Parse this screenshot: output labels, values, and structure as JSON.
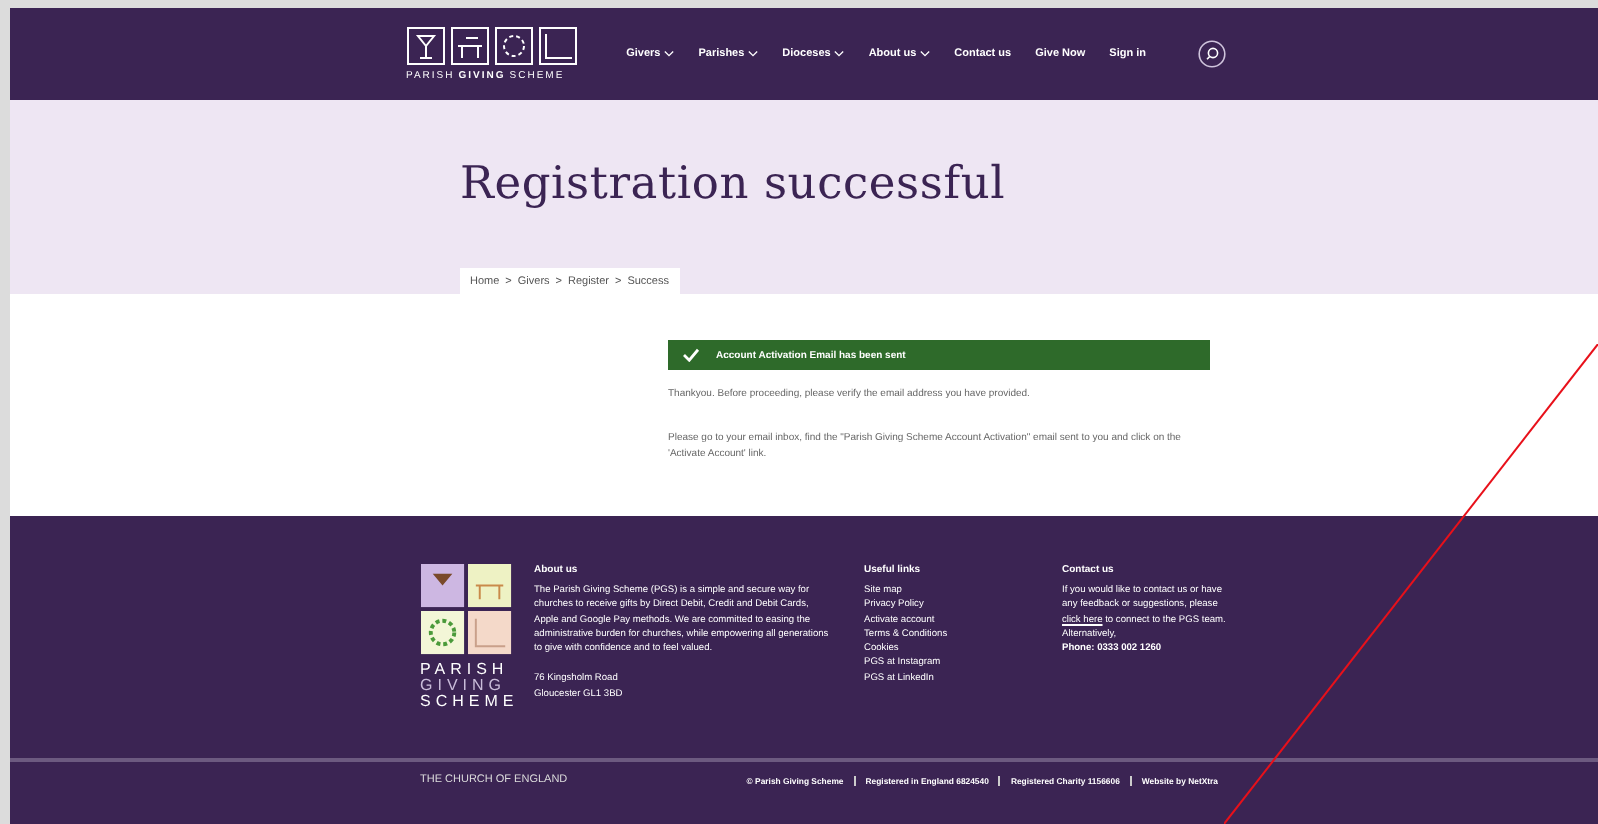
{
  "header": {
    "logo_text": [
      "PARISH",
      "GIVING",
      "SCHEME"
    ],
    "nav": [
      {
        "label": "Givers",
        "dropdown": true
      },
      {
        "label": "Parishes",
        "dropdown": true
      },
      {
        "label": "Dioceses",
        "dropdown": true
      },
      {
        "label": "About us",
        "dropdown": true
      },
      {
        "label": "Contact us",
        "dropdown": false
      },
      {
        "label": "Give Now",
        "dropdown": false
      },
      {
        "label": "Sign in",
        "dropdown": false
      }
    ]
  },
  "hero": {
    "title": "Registration successful",
    "breadcrumb": [
      "Home",
      "Givers",
      "Register",
      "Success"
    ],
    "separator": ">"
  },
  "alert": {
    "text": "Account Activation Email has been sent"
  },
  "paragraphs": [
    "Thankyou. Before proceeding, please verify the email address you have provided.",
    "Please go to your email inbox, find the \"Parish Giving Scheme Account Activation\" email sent to you and click on the 'Activate Account' link."
  ],
  "footer": {
    "logo_text": [
      "PARISH",
      "GIVING",
      "SCHEME"
    ],
    "about": {
      "heading": "About us",
      "text": "The Parish Giving Scheme (PGS) is a simple and secure way for churches to receive gifts by Direct Debit, Credit and Debit Cards, Apple and Google Pay methods. We are committed to easing the administrative burden for churches, while empowering all generations to give with confidence and to feel valued.",
      "address": [
        "76 Kingsholm Road",
        "Gloucester GL1 3BD"
      ]
    },
    "links": {
      "heading": "Useful links",
      "items": [
        "Site map",
        "Privacy Policy",
        "Activate account",
        "Terms & Conditions",
        "Cookies",
        "PGS at Instagram",
        "PGS at LinkedIn"
      ]
    },
    "contact": {
      "heading": "Contact us",
      "before": "If you would like to contact us or have any feedback or suggestions, please",
      "link": "click here",
      "after": "to connect to the PGS team. Alternatively,",
      "phone": "Phone: 0333 002 1260"
    },
    "bottom": {
      "brand": "THE CHURCH OF ENGLAND",
      "items": [
        "© Parish Giving Scheme",
        "Registered in England 6824540",
        "Registered Charity 1156606",
        "Website by NetXtra"
      ]
    }
  }
}
